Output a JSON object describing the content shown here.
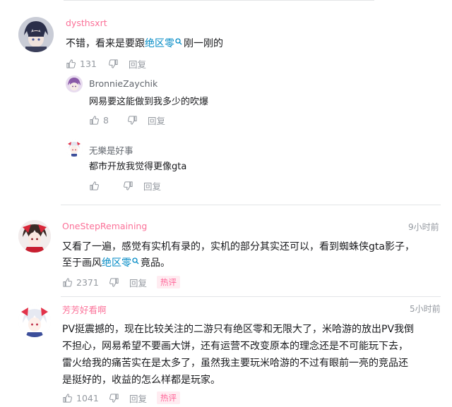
{
  "comments": [
    {
      "username": "dysthsxrt",
      "text_before": "不错，看来是要跟",
      "keyword": "绝区零",
      "text_after": "刚一刚的",
      "likes": "131",
      "reply_label": "回复",
      "replies": [
        {
          "username": "BronnieZaychik",
          "text": "网易要这能做到我多少的吹爆",
          "likes": "8",
          "reply_label": "回复"
        },
        {
          "username": "无樂是好事",
          "text": "都市开放我觉得更像gta",
          "likes": "",
          "reply_label": "回复"
        }
      ]
    },
    {
      "username": "OneStepRemaining",
      "time": "9小时前",
      "line1": "又看了一遍，感觉有实机有录的，实机的部分其实还可以，看到蜘蛛侠gta影子，",
      "line2_before": "至于画风",
      "keyword": "绝区零",
      "line2_after": "竟品。",
      "likes": "2371",
      "reply_label": "回复",
      "badge": "热评"
    },
    {
      "username": "芳芳好看啊",
      "time": "5小时前",
      "lines": [
        "PV挺震撼的，现在比较关注的二游只有绝区零和无限大了，米哈游的放出PV我倒",
        "不担心，网易希望不要画大饼，还有运营不改变原本的理念还是不可能玩下去，",
        "雷火给我的痛苦实在是太多了，虽然我主要玩米哈游的不过有眼前一亮的竞品还",
        "是挺好的，收益的怎么样都是玩家。"
      ],
      "likes": "1041",
      "reply_label": "回复",
      "badge": "热评"
    }
  ],
  "colors": {
    "username_pink": "#fb7299",
    "keyword_blue": "#008ac5",
    "muted": "#9499a0",
    "badge_bg": "#ffecf1"
  },
  "icons": [
    "thumb-up-icon",
    "thumb-down-icon",
    "search-icon"
  ]
}
